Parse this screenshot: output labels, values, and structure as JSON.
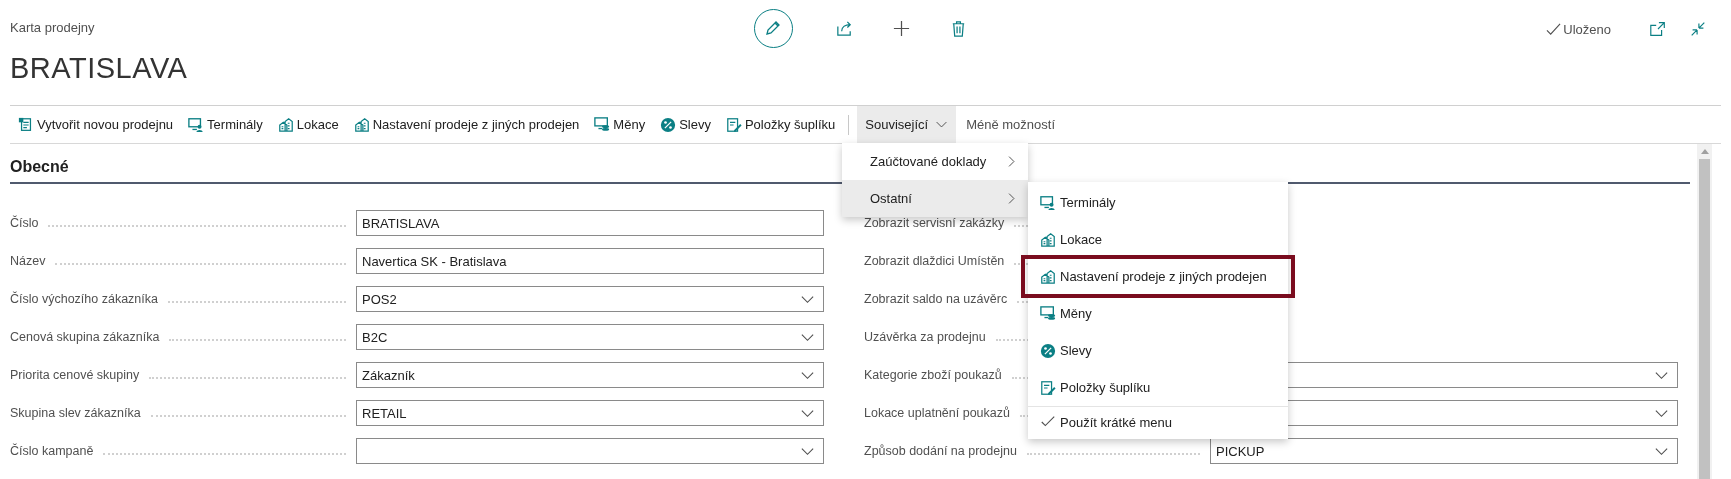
{
  "header": {
    "subtitle": "Karta prodejny",
    "title": "BRATISLAVA",
    "status": "Uloženo"
  },
  "actions": [
    {
      "label": "Vytvořit novou prodejnu",
      "kind": "create"
    },
    {
      "label": "Terminály",
      "kind": "terminals"
    },
    {
      "label": "Lokace",
      "kind": "locations"
    },
    {
      "label": "Nastavení prodeje z jiných prodejen",
      "kind": "locations"
    },
    {
      "label": "Měny",
      "kind": "currencies"
    },
    {
      "label": "Slevy",
      "kind": "discounts"
    },
    {
      "label": "Položky šuplíku",
      "kind": "drawer"
    }
  ],
  "related": {
    "label": "Související",
    "expanded": true
  },
  "less": {
    "label": "Méně možností"
  },
  "section": {
    "title": "Obecné"
  },
  "left_fields": [
    {
      "label": "Číslo",
      "kind": "text",
      "value": "BRATISLAVA"
    },
    {
      "label": "Název",
      "kind": "text",
      "value": "Navertica SK - Bratislava"
    },
    {
      "label": "Číslo výchozího zákazníka",
      "kind": "dropdown",
      "value": "POS2"
    },
    {
      "label": "Cenová skupina zákazníka",
      "kind": "dropdown",
      "value": "B2C"
    },
    {
      "label": "Priorita cenové skupiny",
      "kind": "dropdown",
      "value": "Zákazník"
    },
    {
      "label": "Skupina slev zákazníka",
      "kind": "dropdown",
      "value": "RETAIL"
    },
    {
      "label": "Číslo kampaně",
      "kind": "dropdown"
    }
  ],
  "right_fields": [
    {
      "label": "Zobrazit servisní zakázky",
      "kind": "covered"
    },
    {
      "label": "Zobrazit dlaždici Umístěn",
      "kind": "covered"
    },
    {
      "label": "Zobrazit saldo na uzávěrc",
      "kind": "covered"
    },
    {
      "label": "Uzávěrka za prodejnu",
      "kind": "covered"
    },
    {
      "label": "Kategorie zboží poukazů",
      "kind": "dropdown"
    },
    {
      "label": "Lokace uplatnění poukazů",
      "kind": "dropdown"
    },
    {
      "label": "Způsob dodání na prodejnu",
      "kind": "dropdown",
      "value": "PICKUP"
    }
  ],
  "menu": [
    {
      "label": "Zaúčtované doklady",
      "expanded": false
    },
    {
      "label": "Ostatní",
      "expanded": true
    }
  ],
  "submenu": [
    {
      "label": "Terminály",
      "kind": "terminals",
      "outlined": false
    },
    {
      "label": "Lokace",
      "kind": "locations",
      "outlined": false
    },
    {
      "label": "Nastavení prodeje z jiných prodejen",
      "kind": "locations",
      "outlined": true
    },
    {
      "label": "Měny",
      "kind": "currencies",
      "outlined": false
    },
    {
      "label": "Slevy",
      "kind": "discounts",
      "outlined": false
    },
    {
      "label": "Položky šuplíku",
      "kind": "drawer",
      "outlined": false
    },
    {
      "label": "Použít krátké menu",
      "kind": "option",
      "checked": true
    }
  ]
}
